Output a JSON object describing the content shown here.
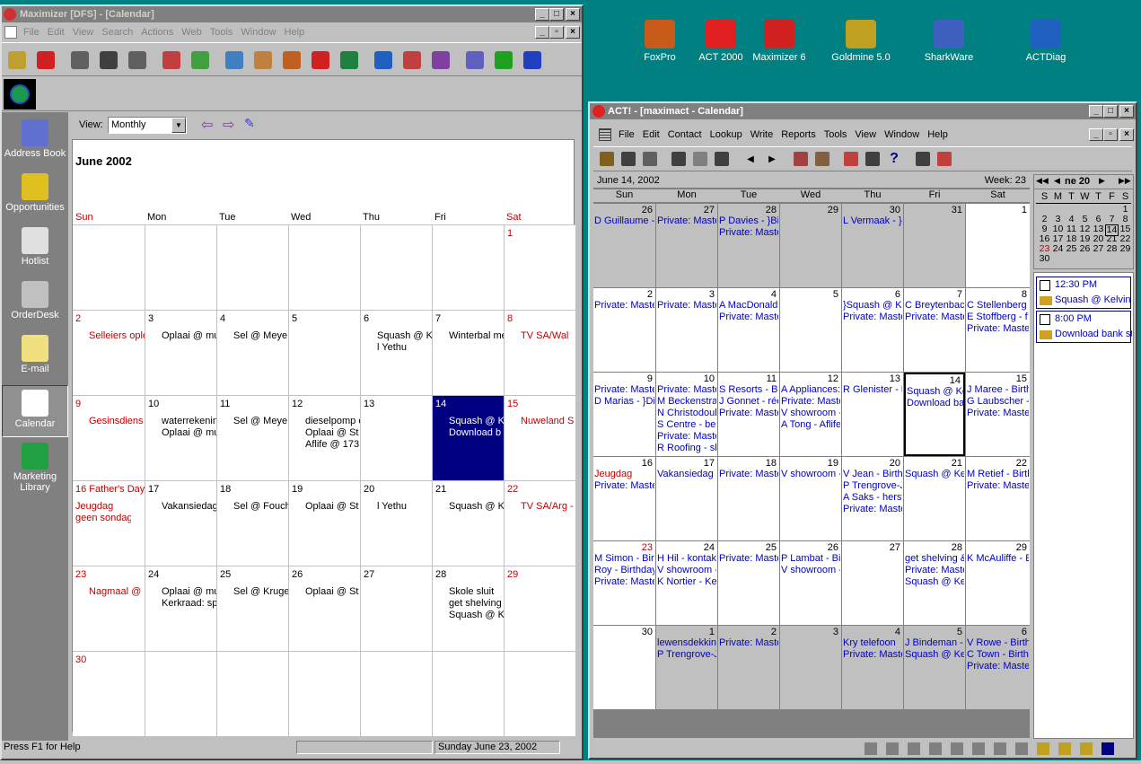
{
  "desktop": {
    "icons": [
      {
        "label": "FoxPro",
        "icon": "foxpro-icon",
        "color": "#c85a1a"
      },
      {
        "label": "ACT 2000",
        "icon": "act-icon",
        "color": "#e02020"
      },
      {
        "label": "Maximizer 6",
        "icon": "maximizer-icon",
        "color": "#d02020"
      },
      {
        "label": "Goldmine 5.0",
        "icon": "goldmine-icon",
        "color": "#c0a020"
      },
      {
        "label": "SharkWare",
        "icon": "sharkware-icon",
        "color": "#4060c0"
      },
      {
        "label": "ACTDiag",
        "icon": "actdiag-icon",
        "color": "#2060c0"
      }
    ]
  },
  "maximizer": {
    "title": "Maximizer [DFS] - [Calendar]",
    "menu": [
      "File",
      "Edit",
      "View",
      "Search",
      "Actions",
      "Web",
      "Tools",
      "Window",
      "Help"
    ],
    "view_label": "View:",
    "view_value": "Monthly",
    "month_title": "June 2002",
    "days": [
      "Sun",
      "Mon",
      "Tue",
      "Wed",
      "Thu",
      "Fri",
      "Sat"
    ],
    "nav": [
      "Address Book",
      "Opportunities",
      "Hotlist",
      "OrderDesk",
      "E-mail",
      "Calendar",
      "Marketing Library"
    ],
    "weeks": [
      [
        {
          "d": "",
          "e": []
        },
        {
          "d": "",
          "e": []
        },
        {
          "d": "",
          "e": []
        },
        {
          "d": "",
          "e": []
        },
        {
          "d": "",
          "e": []
        },
        {
          "d": "",
          "e": []
        },
        {
          "d": "1",
          "e": []
        }
      ],
      [
        {
          "d": "2",
          "e": [
            "Selleiers ople"
          ]
        },
        {
          "d": "3",
          "e": [
            "Oplaai @ mu"
          ]
        },
        {
          "d": "4",
          "e": [
            "Sel @ Meye"
          ]
        },
        {
          "d": "5",
          "e": []
        },
        {
          "d": "6",
          "e": [
            "Squash @ K",
            "l Yethu"
          ]
        },
        {
          "d": "7",
          "e": [
            "Winterbal me"
          ]
        },
        {
          "d": "8",
          "e": [
            "TV  SA/Wal"
          ]
        }
      ],
      [
        {
          "d": "9",
          "e": [
            "Gesinsdiens"
          ]
        },
        {
          "d": "10",
          "e": [
            "waterrekenin",
            "Oplaai @ mu"
          ]
        },
        {
          "d": "11",
          "e": [
            "Sel @ Meye"
          ]
        },
        {
          "d": "12",
          "e": [
            "dieselpomp e",
            "Oplaai @ St",
            "Aflife @ 173"
          ]
        },
        {
          "d": "13",
          "e": []
        },
        {
          "d": "14",
          "e": [
            "Squash @ K",
            "Download b"
          ]
        },
        {
          "d": "15",
          "e": [
            "Nuweland S"
          ]
        }
      ],
      [
        {
          "d": "16 Father's Day",
          "e": [
            "Jeugdag",
            "geen sondag"
          ]
        },
        {
          "d": "17",
          "e": [
            "Vakansiedag"
          ]
        },
        {
          "d": "18",
          "e": [
            "Sel @ Fouch"
          ]
        },
        {
          "d": "19",
          "e": [
            "Oplaai @ St"
          ]
        },
        {
          "d": "20",
          "e": [
            "l Yethu"
          ]
        },
        {
          "d": "21",
          "e": [
            "Squash @ K"
          ]
        },
        {
          "d": "22",
          "e": [
            "TV SA/Arg -"
          ]
        }
      ],
      [
        {
          "d": "23",
          "e": [
            "Nagmaal @"
          ]
        },
        {
          "d": "24",
          "e": [
            "Oplaai @ mu",
            "Kerkraad: sp"
          ]
        },
        {
          "d": "25",
          "e": [
            "Sel @ Kruge"
          ]
        },
        {
          "d": "26",
          "e": [
            "Oplaai @ St"
          ]
        },
        {
          "d": "27",
          "e": []
        },
        {
          "d": "28",
          "e": [
            "Skole sluit",
            "get shelving",
            "Squash @ K"
          ]
        },
        {
          "d": "29",
          "e": []
        }
      ],
      [
        {
          "d": "30",
          "e": []
        },
        {
          "d": "",
          "e": []
        },
        {
          "d": "",
          "e": []
        },
        {
          "d": "",
          "e": []
        },
        {
          "d": "",
          "e": []
        },
        {
          "d": "",
          "e": []
        },
        {
          "d": "",
          "e": []
        }
      ]
    ],
    "status_help": "Press F1 for Help",
    "status_date": "Sunday  June 23, 2002"
  },
  "act": {
    "title": "ACT! - [maximact - Calendar]",
    "menu": [
      "File",
      "Edit",
      "Contact",
      "Lookup",
      "Write",
      "Reports",
      "Tools",
      "View",
      "Window",
      "Help"
    ],
    "date_label": "June 14, 2002",
    "week_label": "Week: 23",
    "days": [
      "Sun",
      "Mon",
      "Tue",
      "Wed",
      "Thu",
      "Fri",
      "Sat"
    ],
    "weeks": [
      [
        {
          "d": "26",
          "g": true,
          "e": [
            "D Guillaume -"
          ]
        },
        {
          "d": "27",
          "g": true,
          "e": [
            "Private: Maste"
          ]
        },
        {
          "d": "28",
          "g": true,
          "e": [
            "P Davies - }Bi",
            "Private: Maste"
          ]
        },
        {
          "d": "29",
          "g": true,
          "e": []
        },
        {
          "d": "30",
          "g": true,
          "e": [
            "L Vermaak - }I"
          ]
        },
        {
          "d": "31",
          "g": true,
          "e": []
        },
        {
          "d": "1",
          "g": false,
          "e": []
        }
      ],
      [
        {
          "d": "2",
          "g": false,
          "e": [
            "Private: Maste"
          ]
        },
        {
          "d": "3",
          "g": false,
          "e": [
            "Private: Maste"
          ]
        },
        {
          "d": "4",
          "g": false,
          "e": [
            "A MacDonald",
            "Private: Maste"
          ]
        },
        {
          "d": "5",
          "g": false,
          "e": []
        },
        {
          "d": "6",
          "g": false,
          "e": [
            "}Squash @ K",
            "Private: Maste"
          ]
        },
        {
          "d": "7",
          "g": false,
          "e": [
            "C Breytenbacl",
            "Private: Maste"
          ]
        },
        {
          "d": "8",
          "g": false,
          "e": [
            "C Stellenberg",
            "E Stoffberg - f",
            "Private: Maste"
          ]
        }
      ],
      [
        {
          "d": "9",
          "g": false,
          "e": [
            "Private: Maste",
            "D Marias - }Di"
          ]
        },
        {
          "d": "10",
          "g": false,
          "e": [
            "Private: Maste",
            "M Beckenstra",
            "N Christodoul",
            "S Centre - bel",
            "Private: Maste",
            "R Roofing - sk"
          ]
        },
        {
          "d": "11",
          "g": false,
          "e": [
            "S Resorts - Bi",
            "J Gonnet - rée",
            "Private: Maste"
          ]
        },
        {
          "d": "12",
          "g": false,
          "e": [
            "A Appliances:",
            "Private: Maste",
            "V showroom -",
            "A Tong - Aflife"
          ]
        },
        {
          "d": "13",
          "g": false,
          "e": [
            "R Glenister - H"
          ]
        },
        {
          "d": "14",
          "g": false,
          "sel": true,
          "e": [
            "Squash @ Ke",
            "Download bar"
          ]
        },
        {
          "d": "15",
          "g": false,
          "e": [
            "J Maree - Birth",
            "G Laubscher -",
            "Private: Maste"
          ]
        }
      ],
      [
        {
          "d": "16",
          "g": false,
          "e": [
            "Jeugdag",
            "Private: Maste"
          ]
        },
        {
          "d": "17",
          "g": false,
          "e": [
            "Vakansiedag"
          ]
        },
        {
          "d": "18",
          "g": false,
          "e": [
            "Private: Maste"
          ]
        },
        {
          "d": "19",
          "g": false,
          "e": [
            "V showroom -"
          ]
        },
        {
          "d": "20",
          "g": false,
          "e": [
            "V Jean - Birthd",
            "P Trengrove-J",
            "A Saks - herst",
            "Private: Maste"
          ]
        },
        {
          "d": "21",
          "g": false,
          "e": [
            "Squash @ Ke"
          ]
        },
        {
          "d": "22",
          "g": false,
          "e": [
            "M Retief - Birtl",
            "Private: Maste"
          ]
        }
      ],
      [
        {
          "d": "23",
          "g": false,
          "e": [
            "M Simon - Birt",
            "Roy - Birthday",
            "Private: Maste"
          ]
        },
        {
          "d": "24",
          "g": false,
          "e": [
            "H Hil - kontak",
            "V showroom -",
            "K Nortier - Ker"
          ]
        },
        {
          "d": "25",
          "g": false,
          "e": [
            "Private: Maste"
          ]
        },
        {
          "d": "26",
          "g": false,
          "e": [
            "P Lambat - Bir",
            "V showroom -"
          ]
        },
        {
          "d": "27",
          "g": false,
          "e": []
        },
        {
          "d": "28",
          "g": false,
          "e": [
            "get shelving &",
            "Private: Maste",
            "Squash @ Ke"
          ]
        },
        {
          "d": "29",
          "g": false,
          "e": [
            "K McAuliffe - E"
          ]
        }
      ],
      [
        {
          "d": "30",
          "g": false,
          "e": []
        },
        {
          "d": "1",
          "g": true,
          "e": [
            "lewensdekkin",
            "P Trengrove-J"
          ]
        },
        {
          "d": "2",
          "g": true,
          "e": [
            "Private: Maste"
          ]
        },
        {
          "d": "3",
          "g": true,
          "e": []
        },
        {
          "d": "4",
          "g": true,
          "e": [
            "Kry   telefoon",
            "Private: Maste"
          ]
        },
        {
          "d": "5",
          "g": true,
          "e": [
            "J Bindeman - I",
            "Squash @ Ke"
          ]
        },
        {
          "d": "6",
          "g": true,
          "e": [
            "V Rowe - Birth",
            "C Town - Birth",
            "Private: Maste"
          ]
        }
      ]
    ],
    "mini": {
      "header": "ne 20",
      "days": [
        "S",
        "M",
        "T",
        "W",
        "T",
        "F",
        "S"
      ],
      "rows": [
        [
          "",
          "",
          "",
          "",
          "",
          "",
          "1"
        ],
        [
          "2",
          "3",
          "4",
          "5",
          "6",
          "7",
          "8"
        ],
        [
          "9",
          "10",
          "11",
          "12",
          "13",
          "14",
          "15"
        ],
        [
          "16",
          "17",
          "18",
          "19",
          "20",
          "21",
          "22"
        ],
        [
          "23",
          "24",
          "25",
          "26",
          "27",
          "28",
          "29"
        ],
        [
          "30",
          "",
          "",
          "",
          "",
          "",
          ""
        ]
      ]
    },
    "tasks": [
      {
        "time": "12:30 PM",
        "text": "Squash @ Kelvin"
      },
      {
        "time": "8:00 PM",
        "text": "Download bank st"
      }
    ]
  },
  "colors": {
    "desktop": "#008080",
    "selected": "#000080",
    "red_text": "#c00000",
    "blue_text": "#0000c0"
  }
}
